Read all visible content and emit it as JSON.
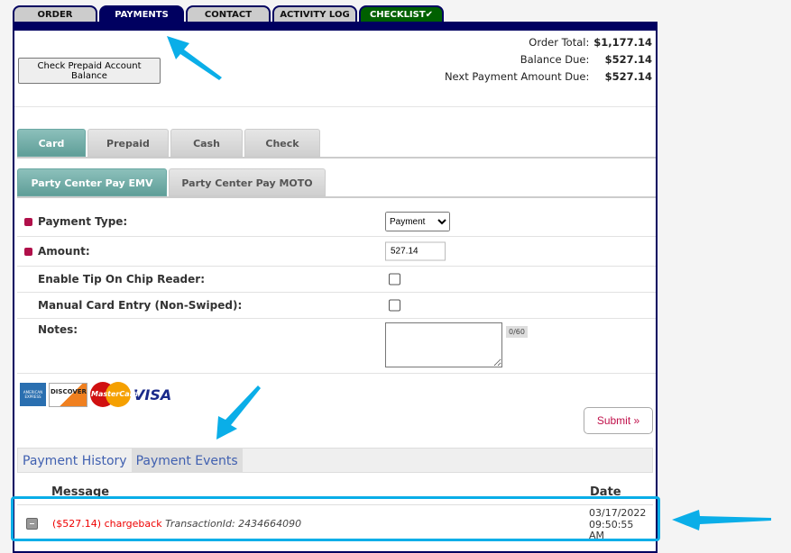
{
  "top_tabs": [
    {
      "label": "ORDER"
    },
    {
      "label": "PAYMENTS",
      "active": true
    },
    {
      "label": "CONTACT"
    },
    {
      "label": "ACTIVITY LOG"
    },
    {
      "label": "CHECKLIST✔"
    }
  ],
  "prepaid_button": "Check Prepaid Account Balance",
  "totals": [
    {
      "label": "Order Total:",
      "value": "$1,177.14"
    },
    {
      "label": "Balance Due:",
      "value": "$527.14"
    },
    {
      "label": "Next Payment Amount Due:",
      "value": "$527.14"
    }
  ],
  "method_tabs": [
    {
      "label": "Card",
      "active": true
    },
    {
      "label": "Prepaid"
    },
    {
      "label": "Cash"
    },
    {
      "label": "Check"
    }
  ],
  "processor_tabs": [
    {
      "label": "Party Center Pay EMV",
      "active": true
    },
    {
      "label": "Party Center Pay MOTO"
    }
  ],
  "form": {
    "payment_type_label": "Payment Type:",
    "payment_type_value": "Payment",
    "amount_label": "Amount:",
    "amount_value": "527.14",
    "tip_label": "Enable Tip On Chip Reader:",
    "manual_label": "Manual Card Entry (Non-Swiped):",
    "notes_label": "Notes:",
    "notes_count": "0/60"
  },
  "cards": [
    "AMERICAN EXPRESS",
    "DISCOVER",
    "MasterCard",
    "VISA"
  ],
  "submit_label": "Submit »",
  "history_tabs": [
    {
      "label": "Payment History"
    },
    {
      "label": "Payment Events",
      "active": true
    }
  ],
  "events": {
    "headers": {
      "message": "Message",
      "date": "Date"
    },
    "rows": [
      {
        "amount": "($527.14)",
        "type": "chargeback",
        "transaction": "TransactionId: 2434664090",
        "date_line1": "03/17/2022",
        "date_line2": "09:50:55",
        "date_line3": "AM"
      }
    ]
  },
  "colors": {
    "navy": "#000060",
    "accent_teal": "#6aa8a3",
    "annotation": "#0aaee8",
    "alert": "#e00000"
  }
}
